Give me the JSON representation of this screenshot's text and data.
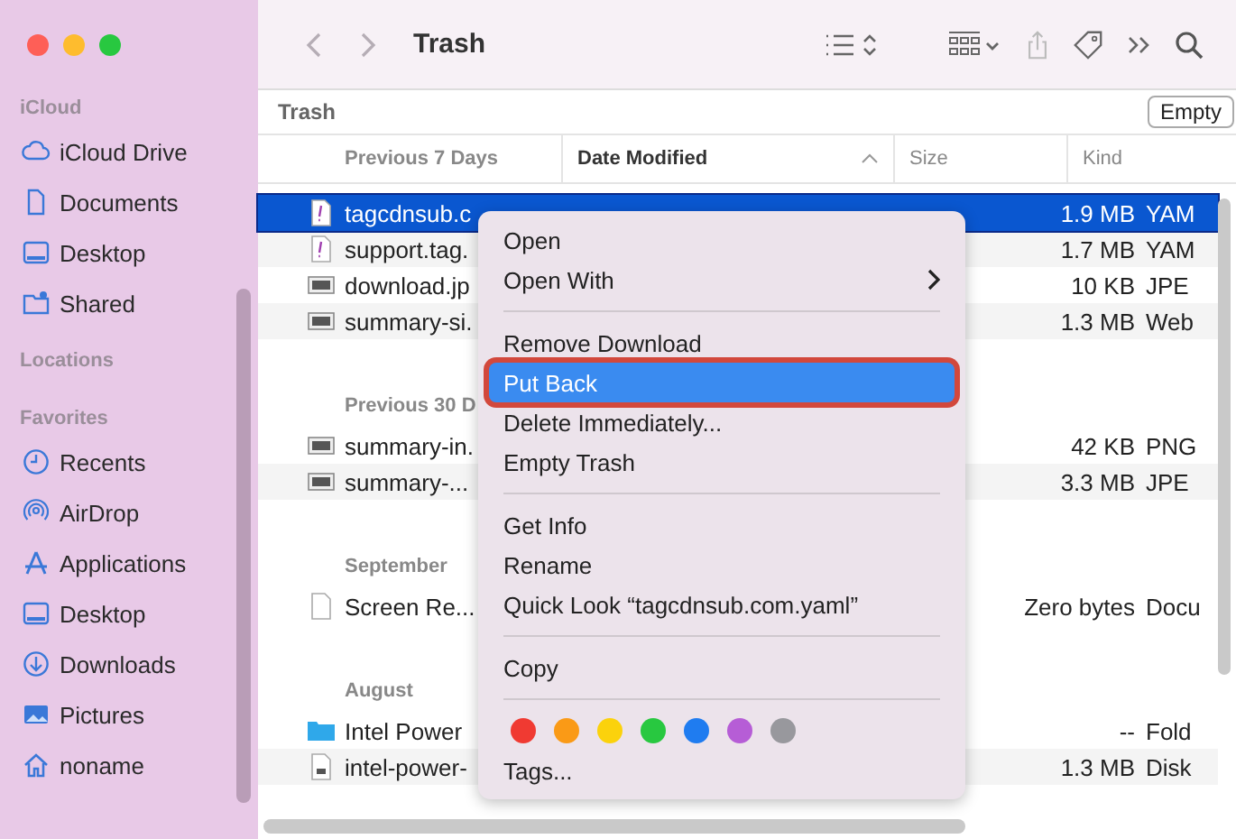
{
  "window": {
    "title": "Trash"
  },
  "sidebar": {
    "sections": [
      {
        "heading": "iCloud",
        "items": [
          {
            "label": "iCloud Drive",
            "kind": "cloud"
          },
          {
            "label": "Documents",
            "kind": "doc"
          },
          {
            "label": "Desktop",
            "kind": "desktop"
          },
          {
            "label": "Shared",
            "kind": "shared"
          }
        ]
      },
      {
        "heading": "Locations"
      },
      {
        "heading": "Favorites",
        "items": [
          {
            "label": "Recents",
            "kind": "clock"
          },
          {
            "label": "AirDrop",
            "kind": "airdrop"
          },
          {
            "label": "Applications",
            "kind": "apps"
          },
          {
            "label": "Desktop",
            "kind": "desktop"
          },
          {
            "label": "Downloads",
            "kind": "download"
          },
          {
            "label": "Pictures",
            "kind": "pictures"
          },
          {
            "label": "noname",
            "kind": "home"
          }
        ]
      }
    ]
  },
  "path_bar": {
    "label": "Trash",
    "button": "Empty"
  },
  "table": {
    "columns": [
      {
        "label": "Date Modified",
        "sorted": true
      },
      {
        "label": "Size",
        "sorted": false
      },
      {
        "label": "Kind",
        "sorted": false
      }
    ],
    "groups": [
      {
        "label": "Previous 7 Days",
        "rows": [
          {
            "name": "tagcdnsub.c",
            "kind": "yaml",
            "size": "1.9 MB",
            "file_kind": "YAM",
            "selected": true
          },
          {
            "name": "support.tag.",
            "kind": "yaml",
            "size": "1.7 MB",
            "file_kind": "YAM",
            "selected": false
          },
          {
            "name": "download.jp",
            "kind": "image",
            "size": "10 KB",
            "file_kind": "JPE",
            "selected": false
          },
          {
            "name": "summary-si.",
            "kind": "image",
            "size": "1.3 MB",
            "file_kind": "Web",
            "selected": false
          }
        ]
      },
      {
        "label": "Previous 30 D",
        "rows": [
          {
            "name": "summary-in.",
            "kind": "image",
            "size": "42 KB",
            "file_kind": "PNG",
            "selected": false
          },
          {
            "name": "summary-...",
            "kind": "image",
            "size": "3.3 MB",
            "file_kind": "JPE",
            "selected": false
          }
        ]
      },
      {
        "label": "September",
        "rows": [
          {
            "name": "Screen Re...",
            "kind": "doc",
            "size": "Zero bytes",
            "file_kind": "Docu",
            "selected": false
          }
        ]
      },
      {
        "label": "August",
        "rows": [
          {
            "name": "Intel Power",
            "kind": "folder",
            "size": "--",
            "file_kind": "Fold",
            "selected": false
          },
          {
            "name": "intel-power-",
            "kind": "disk",
            "size": "1.3 MB",
            "file_kind": "Disk",
            "selected": false
          }
        ]
      }
    ]
  },
  "context_menu": {
    "items": [
      {
        "kind": "item",
        "label": "Open",
        "submenu": false,
        "selected": false,
        "circled": false
      },
      {
        "kind": "item",
        "label": "Open With",
        "submenu": true,
        "selected": false,
        "circled": false
      },
      {
        "kind": "separator"
      },
      {
        "kind": "item",
        "label": "Remove Download",
        "submenu": false,
        "selected": false,
        "circled": false
      },
      {
        "kind": "item",
        "label": "Put Back",
        "submenu": false,
        "selected": true,
        "circled": true
      },
      {
        "kind": "item",
        "label": "Delete Immediately...",
        "submenu": false,
        "selected": false,
        "circled": false
      },
      {
        "kind": "item",
        "label": "Empty Trash",
        "submenu": false,
        "selected": false,
        "circled": false
      },
      {
        "kind": "separator"
      },
      {
        "kind": "item",
        "label": "Get Info",
        "submenu": false,
        "selected": false,
        "circled": false
      },
      {
        "kind": "item",
        "label": "Rename",
        "submenu": false,
        "selected": false,
        "circled": false
      },
      {
        "kind": "item",
        "label": "Quick Look “tagcdnsub.com.yaml”",
        "submenu": false,
        "selected": false,
        "circled": false
      },
      {
        "kind": "separator"
      },
      {
        "kind": "item",
        "label": "Copy",
        "submenu": false,
        "selected": false,
        "circled": false
      },
      {
        "kind": "separator"
      },
      {
        "kind": "tags",
        "colors": [
          {
            "color": "#f03a32"
          },
          {
            "color": "#fa9a16"
          },
          {
            "color": "#fbd20c"
          },
          {
            "color": "#28c840"
          },
          {
            "color": "#1f7cf0"
          },
          {
            "color": "#b65dd6"
          },
          {
            "color": "#98989d"
          }
        ]
      },
      {
        "kind": "item",
        "label": "Tags...",
        "submenu": false,
        "selected": false,
        "circled": false
      }
    ]
  }
}
